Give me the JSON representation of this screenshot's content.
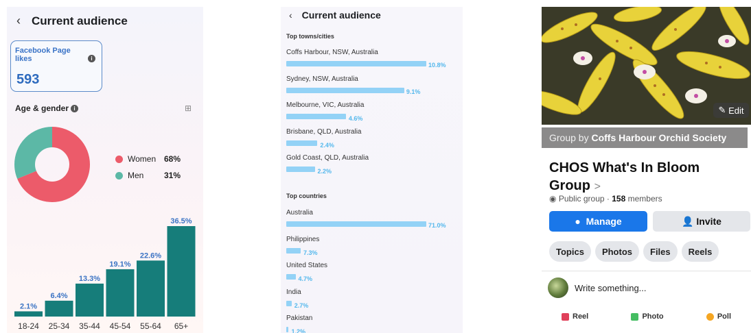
{
  "audience_panel": {
    "title": "Current audience",
    "likes_label": "Facebook Page likes",
    "likes_value": "593",
    "age_gender_title": "Age & gender",
    "gender": [
      {
        "name": "Women",
        "pct": "68%",
        "value": 68,
        "color": "#ec5b6a"
      },
      {
        "name": "Men",
        "pct": "31%",
        "value": 31,
        "color": "#5cb8a6"
      }
    ]
  },
  "locations_panel": {
    "title": "Current audience",
    "towns_title": "Top towns/cities",
    "towns": [
      {
        "name": "Coffs Harbour, NSW, Australia",
        "pct": "10.8%",
        "value": 10.8
      },
      {
        "name": "Sydney, NSW, Australia",
        "pct": "9.1%",
        "value": 9.1
      },
      {
        "name": "Melbourne, VIC, Australia",
        "pct": "4.6%",
        "value": 4.6
      },
      {
        "name": "Brisbane, QLD, Australia",
        "pct": "2.4%",
        "value": 2.4
      },
      {
        "name": "Gold Coast, QLD, Australia",
        "pct": "2.2%",
        "value": 2.2
      }
    ],
    "countries_title": "Top countries",
    "countries": [
      {
        "name": "Australia",
        "pct": "71.0%",
        "value": 71.0
      },
      {
        "name": "Philippines",
        "pct": "7.3%",
        "value": 7.3
      },
      {
        "name": "United States",
        "pct": "4.7%",
        "value": 4.7
      },
      {
        "name": "India",
        "pct": "2.7%",
        "value": 2.7
      },
      {
        "name": "Pakistan",
        "pct": "1.2%",
        "value": 1.2
      }
    ]
  },
  "group_panel": {
    "edit_label": "Edit",
    "group_by_prefix": "Group by",
    "group_by_name": "Coffs Harbour Orchid Society",
    "group_name": "CHOS What's In Bloom Group",
    "chevron": ">",
    "privacy": "Public group",
    "separator": "·",
    "member_count": "158",
    "members_label": "members",
    "manage_label": "Manage",
    "invite_label": "Invite",
    "tabs": [
      "Topics",
      "Photos",
      "Files",
      "Reels"
    ],
    "composer_placeholder": "Write something...",
    "actions": [
      {
        "label": "Reel",
        "color": "#e0405a"
      },
      {
        "label": "Photo",
        "color": "#45bd62"
      },
      {
        "label": "Poll",
        "color": "#f5a623"
      }
    ],
    "accent_color": "#1a77e9"
  },
  "chart_data": [
    {
      "type": "pie",
      "labels": [
        "Women",
        "Men"
      ],
      "values": [
        68,
        31
      ],
      "title": "Age & gender"
    },
    {
      "type": "bar",
      "categories": [
        "18-24",
        "25-34",
        "35-44",
        "45-54",
        "55-64",
        "65+"
      ],
      "values": [
        2.1,
        6.4,
        13.3,
        19.1,
        22.6,
        36.5
      ],
      "labels": [
        "2.1%",
        "6.4%",
        "13.3%",
        "19.1%",
        "22.6%",
        "36.5%"
      ],
      "color": "#167d7a"
    },
    {
      "type": "bar",
      "title": "Top towns/cities",
      "categories": [
        "Coffs Harbour, NSW, Australia",
        "Sydney, NSW, Australia",
        "Melbourne, VIC, Australia",
        "Brisbane, QLD, Australia",
        "Gold Coast, QLD, Australia"
      ],
      "values": [
        10.8,
        9.1,
        4.6,
        2.4,
        2.2
      ]
    },
    {
      "type": "bar",
      "title": "Top countries",
      "categories": [
        "Australia",
        "Philippines",
        "United States",
        "India",
        "Pakistan"
      ],
      "values": [
        71.0,
        7.3,
        4.7,
        2.7,
        1.2
      ]
    }
  ]
}
